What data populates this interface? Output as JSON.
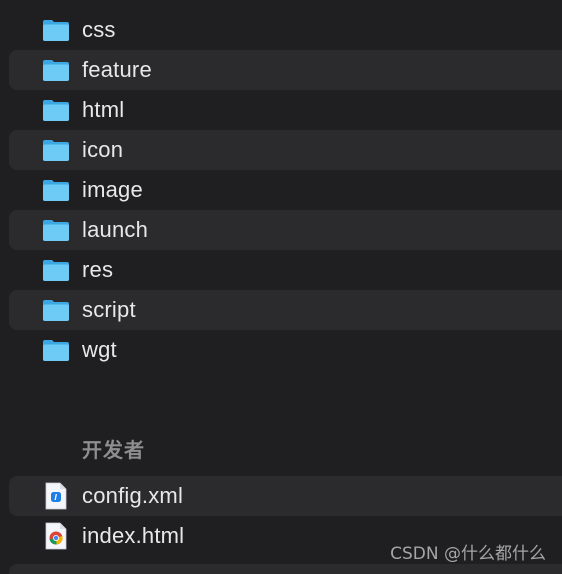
{
  "folders": [
    {
      "label": "css",
      "icon": "folder-icon"
    },
    {
      "label": "feature",
      "icon": "folder-icon"
    },
    {
      "label": "html",
      "icon": "folder-icon"
    },
    {
      "label": "icon",
      "icon": "folder-icon"
    },
    {
      "label": "image",
      "icon": "folder-icon"
    },
    {
      "label": "launch",
      "icon": "folder-icon"
    },
    {
      "label": "res",
      "icon": "folder-icon"
    },
    {
      "label": "script",
      "icon": "folder-icon"
    },
    {
      "label": "wgt",
      "icon": "folder-icon"
    }
  ],
  "section_title": "开发者",
  "files": [
    {
      "label": "config.xml",
      "icon": "xml-document-icon"
    },
    {
      "label": "index.html",
      "icon": "chrome-html-document-icon"
    }
  ],
  "watermark": "CSDN @什么都什么",
  "colors": {
    "background": "#1f1f21",
    "row_alt": "#2b2b2d",
    "folder_light": "#6ecbf5",
    "folder_dark": "#3ba7e3",
    "text": "#e8e8e8",
    "section_text": "#8e8e90"
  }
}
